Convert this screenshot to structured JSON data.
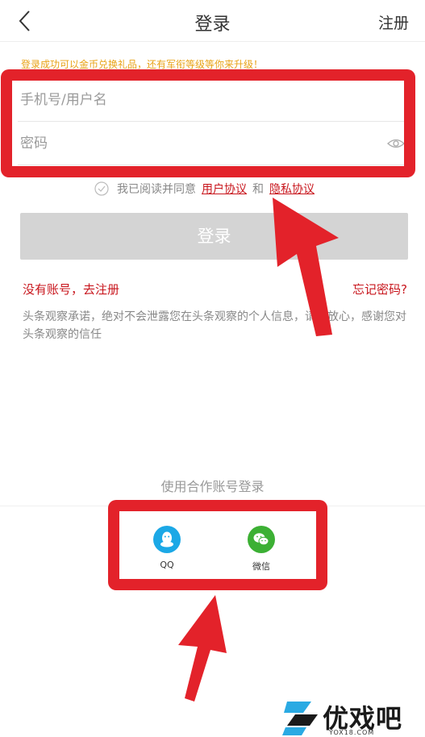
{
  "header": {
    "title": "登录",
    "register_label": "注册"
  },
  "promo_text": "登录成功可以金币兑换礼品，还有军衔等级等你来升级！",
  "form": {
    "username_placeholder": "手机号/用户名",
    "password_placeholder": "密码"
  },
  "agreement": {
    "prefix": "我已阅读并同意",
    "user_agreement": "用户协议",
    "and": "和",
    "privacy_agreement": "隐私协议"
  },
  "login_button": "登录",
  "links": {
    "no_account": "没有账号，去注册",
    "forgot_password": "忘记密码?"
  },
  "notice": "头条观察承诺，绝对不会泄露您在头条观察的个人信息，请您放心，感谢您对头条观察的信任",
  "partner": {
    "title": "使用合作账号登录",
    "qq_label": "QQ",
    "wechat_label": "微信"
  },
  "watermark": {
    "text": "优戏吧",
    "url": "YOX18.COM"
  },
  "colors": {
    "accent_red": "#c8161d",
    "annotation_red": "#e3222a",
    "promo_orange": "#e8a317",
    "qq_blue": "#1ba8e6",
    "wechat_green": "#3cb034",
    "disabled_button": "#d4d4d4"
  }
}
